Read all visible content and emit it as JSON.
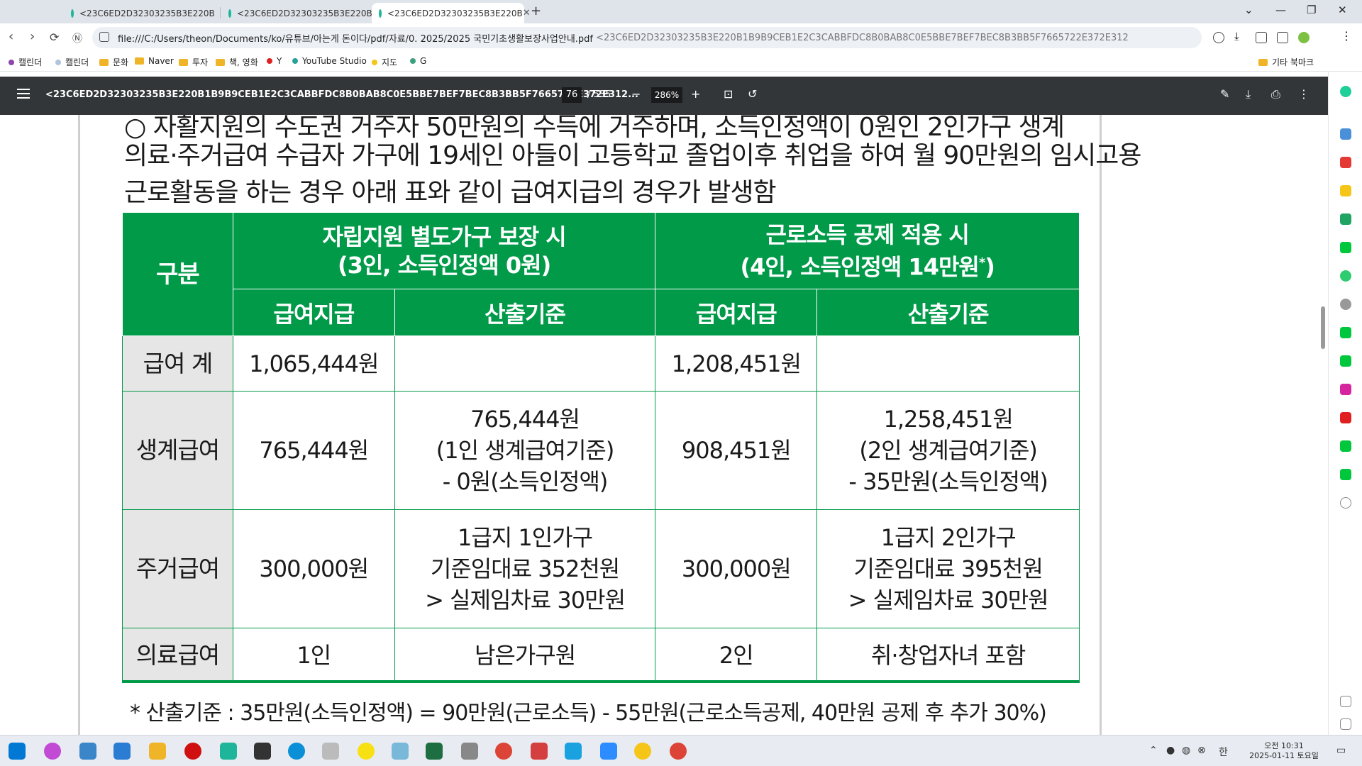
{
  "browser": {
    "tabs": [
      {
        "label": "<23C6ED2D32303235B3E220B",
        "active": false
      },
      {
        "label": "<23C6ED2D32303235B3E220B",
        "active": false
      },
      {
        "label": "<23C6ED2D32303235B3E220B",
        "active": true
      }
    ],
    "address": "file:///C:/Users/theon/Documents/ko/유튜브/아는게 돈이다/pdf/자료/0. 2025/2025 국민기초생활보장사업안내.pdf",
    "address_tail": "<23C6ED2D32303235B3E220B1B9B9CEB1E2C3CABBFDC8B0BAB8C0E5BBE7BEF7BEC8B3BB5F7665722E372E312",
    "bookmarks": [
      "캘린더",
      "캘린더",
      "문화",
      "Naver",
      "투자",
      "책, 영화",
      "Y",
      "YouTube Studio",
      "지도",
      "G"
    ],
    "other_bookmarks": "기타 북마크"
  },
  "pdf_toolbar": {
    "title": "<23C6ED2D32303235B3E220B1B9B9CEB1E2C3CABBFDC8B0BAB8C0E5BBE7BEF7BEC8B3BB5F7665722E372E312...",
    "page": "76",
    "total": "/ 535",
    "zoom": "286%"
  },
  "document": {
    "cut_line": "○ 자활지원의 수도권 거주자 50만원의 수득에 거주하며, 소득인정액이 0원인 2인가구 생계",
    "intro_line1": "의료·주거급여 수급자 가구에 19세인 아들이 고등학교 졸업이후 취업을 하여 월 90만원의 임시고용",
    "intro_line2": "근로활동을 하는 경우 아래 표와 같이 급여지급의 경우가 발생함",
    "table": {
      "corner": "구분",
      "group1": {
        "line1": "자립지원 별도가구 보장 시",
        "line2": "(3인, 소득인정액 0원)"
      },
      "group2": {
        "line1": "근로소득 공제 적용 시",
        "line2": "(4인, 소득인정액 14만원",
        "sup": "*",
        "line2_end": ")"
      },
      "sub": {
        "pay": "급여지급",
        "basis": "산출기준"
      },
      "rows": [
        {
          "label": "급여 계",
          "pay1": "1,065,444원",
          "basis1": [],
          "pay2": "1,208,451원",
          "basis2": []
        },
        {
          "label": "생계급여",
          "pay1": "765,444원",
          "basis1": [
            "765,444원",
            "(1인 생계급여기준)",
            "- 0원(소득인정액)"
          ],
          "pay2": "908,451원",
          "basis2": [
            "1,258,451원",
            "(2인 생계급여기준)",
            "- 35만원(소득인정액)"
          ]
        },
        {
          "label": "주거급여",
          "pay1": "300,000원",
          "basis1": [
            "1급지 1인가구",
            "기준임대료 352천원",
            "> 실제임차료 30만원"
          ],
          "pay2": "300,000원",
          "basis2": [
            "1급지 2인가구",
            "기준임대료 395천원",
            "> 실제임차료 30만원"
          ]
        },
        {
          "label": "의료급여",
          "pay1": "1인",
          "basis1": [
            "남은가구원"
          ],
          "pay2": "2인",
          "basis2": [
            "취·창업자녀 포함"
          ]
        }
      ]
    },
    "footnote": "* 산출기준 : 35만원(소득인정액) = 90만원(근로소득) - 55만원(근로소득공제, 40만원 공제 후 추가 30%)"
  },
  "taskbar": {
    "time": "오전 10:31",
    "date": "2025-01-11 토요일",
    "ime": "한"
  },
  "colors": {
    "table_green": "#009a49",
    "row_header_gray": "#e6e6e6",
    "pdf_toolbar": "#323639",
    "tabstrip": "#dfe3ea"
  }
}
